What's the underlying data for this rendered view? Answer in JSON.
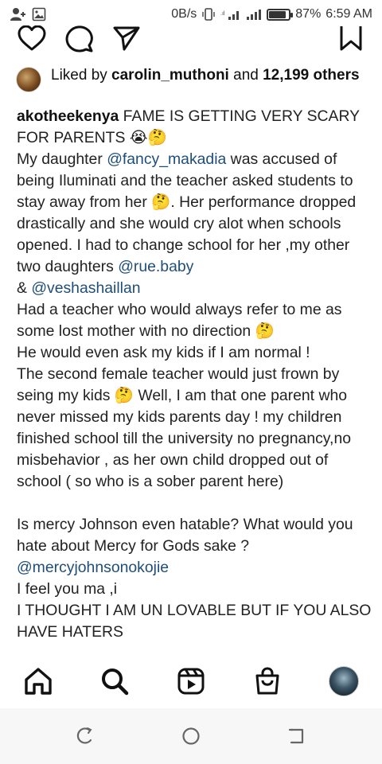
{
  "status_bar": {
    "speed": "0B/s",
    "battery": "87%",
    "battery_level": 0.87,
    "time": "6:59 AM",
    "icons": [
      "add-person-icon",
      "image-icon",
      "vibrate-icon",
      "signal-icon",
      "signal-icon",
      "battery-icon"
    ]
  },
  "post_actions": {
    "icons": [
      "heart-icon",
      "comment-icon",
      "share-icon",
      "bookmark-icon"
    ]
  },
  "likes": {
    "prefix": "Liked by ",
    "user": "carolin_muthoni",
    "middle": " and ",
    "count": "12,199 others"
  },
  "caption": {
    "username": "akotheekenya",
    "lines": [
      [
        {
          "t": " FAME IS GETTING VERY SCARY FOR PARENTS 😭🤔"
        }
      ],
      [
        {
          "t": "My daughter "
        },
        {
          "m": "@fancy_makadia"
        },
        {
          "t": " was accused of being Iluminati and the teacher asked students to stay away from her 🤔. Her performance dropped drastically and she would cry alot when schools opened. I had to change school for her ,my  other  two daughters "
        },
        {
          "m": "@rue.baby"
        }
      ],
      [
        {
          "t": "& "
        },
        {
          "m": "@veshashaillan"
        }
      ],
      [
        {
          "t": "Had a teacher who would always refer to me as some lost mother with no direction 🤔"
        }
      ],
      [
        {
          "t": "He would even ask my kids if I am normal !"
        }
      ],
      [
        {
          "t": "The second female teacher  would just frown by seing my kids 🤔 Well, I am that one parent who never missed my kids parents day !  my children finished school till the university no pregnancy,no misbehavior ,  as her own child dropped out of school ( so who is a sober parent here)"
        }
      ],
      [],
      [
        {
          "t": "Is mercy Johnson even  hatable? What would you hate about Mercy for Gods sake ?"
        }
      ],
      [
        {
          "m": "@mercyjohnsonokojie"
        }
      ],
      [
        {
          "t": "I feel you ma ,i"
        }
      ],
      [
        {
          "t": "I THOUGHT I AM UN LOVABLE BUT IF YOU ALSO HAVE HATERS"
        }
      ]
    ]
  },
  "bottom_nav": {
    "items": [
      "home-icon",
      "search-icon",
      "reels-icon",
      "shop-icon",
      "profile-avatar"
    ]
  },
  "system_nav": {
    "items": [
      "recents-icon",
      "home-circle-icon",
      "back-icon"
    ]
  }
}
